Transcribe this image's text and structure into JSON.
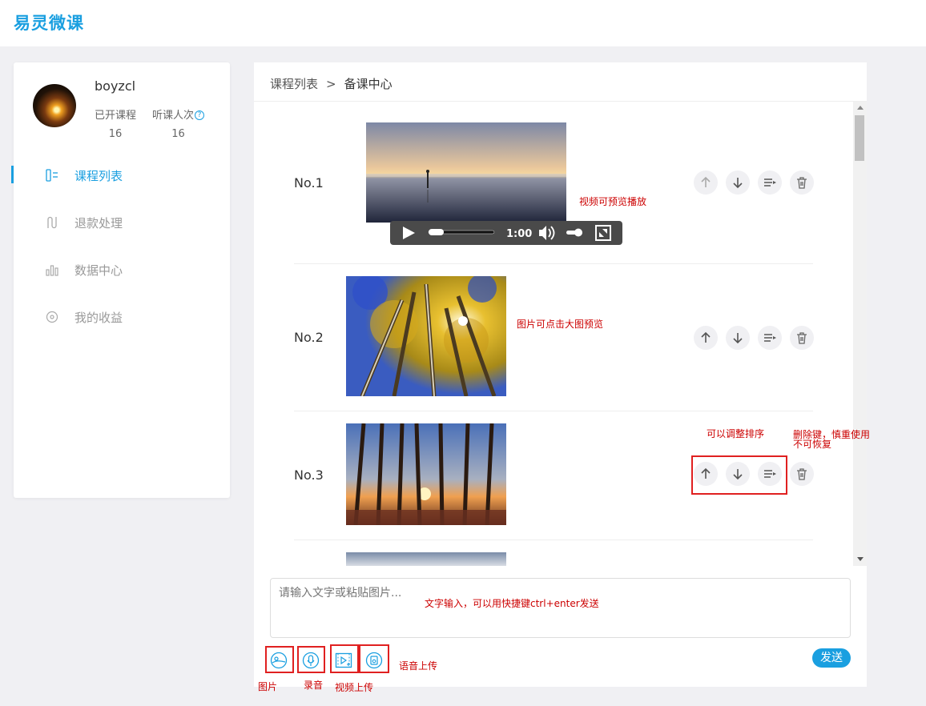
{
  "app": {
    "title": "易灵微课"
  },
  "profile": {
    "username": "boyzcl",
    "stats": [
      {
        "label": "已开课程",
        "value": "16"
      },
      {
        "label": "听课人次",
        "value": "16",
        "help": "?"
      }
    ]
  },
  "nav": [
    {
      "label": "课程列表",
      "icon": "course-list-icon",
      "active": true
    },
    {
      "label": "退款处理",
      "icon": "refund-icon",
      "active": false
    },
    {
      "label": "数据中心",
      "icon": "bar-chart-icon",
      "active": false
    },
    {
      "label": "我的收益",
      "icon": "earnings-icon",
      "active": false
    }
  ],
  "breadcrumb": {
    "parent": "课程列表",
    "separator": ">",
    "current": "备课中心"
  },
  "items": [
    {
      "no": "No.1",
      "type": "video",
      "time": "1:00"
    },
    {
      "no": "No.2",
      "type": "image"
    },
    {
      "no": "No.3",
      "type": "image"
    }
  ],
  "notes": {
    "video": "视频可预览播放",
    "image": "图片可点击大图预览",
    "reorder": "可以调整排序",
    "delete_line1": "删除键，慎重使用",
    "delete_line2": "不可恢复",
    "text_input": "文字输入，可以用快捷键ctrl+enter发送",
    "image_tool": "图片",
    "record_tool": "录音",
    "video_tool": "视频上传",
    "audio_upload": "语音上传"
  },
  "composer": {
    "placeholder": "请输入文字或粘贴图片...",
    "send_label": "发送"
  },
  "colors": {
    "accent": "#1a9fe0",
    "note": "#cc0000",
    "highlight": "#e02020"
  }
}
